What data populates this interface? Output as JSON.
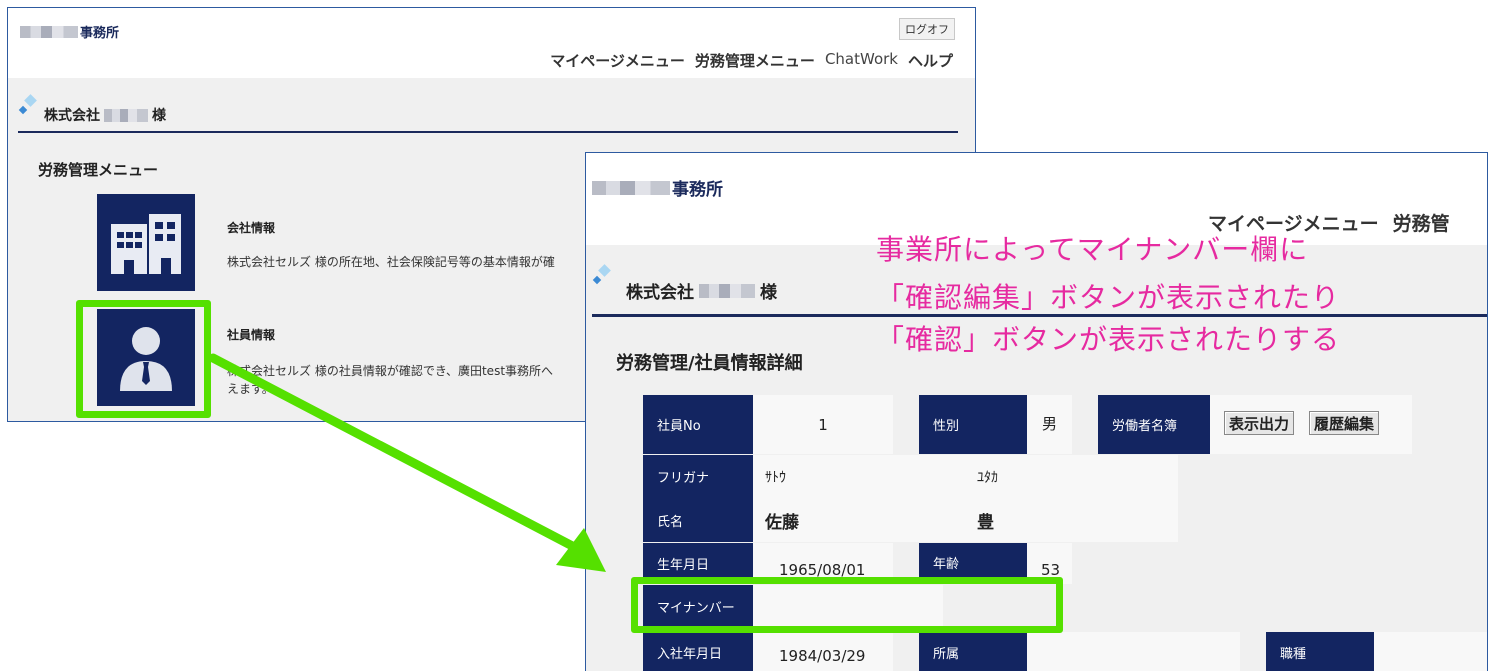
{
  "back_window": {
    "office_suffix": "事務所",
    "logoff_label": "ログオフ",
    "nav": [
      "マイページメニュー",
      "労務管理メニュー",
      "ChatWork",
      "ヘルプ"
    ],
    "company_prefix": "株式会社",
    "company_suffix": "様",
    "section_title": "労務管理メニュー",
    "cards": [
      {
        "title": "会社情報",
        "desc": "株式会社セルズ 様の所在地、社会保険記号等の基本情報が確",
        "icon": "building-icon"
      },
      {
        "title": "社員情報",
        "desc_line1": "株式会社セルズ 様の社員情報が確認でき、廣田test事務所へ",
        "desc_line2": "えます。",
        "icon": "person-icon"
      }
    ]
  },
  "front_window": {
    "office_suffix": "事務所",
    "nav": [
      "マイページメニュー",
      "労務管"
    ],
    "company_prefix": "株式会社",
    "company_suffix": "様",
    "section_title": "労務管理/社員情報詳細",
    "fields": {
      "employee_no_label": "社員No",
      "employee_no": "1",
      "gender_label": "性別",
      "gender": "男",
      "roster_label": "労働者名簿",
      "print_button": "表示出力",
      "history_button": "履歴編集",
      "furigana_label": "フリガナ",
      "furigana_last": "ｻﾄｳ",
      "furigana_first": "ﾕﾀｶ",
      "name_label": "氏名",
      "name_last": "佐藤",
      "name_first": "豊",
      "birthdate_label": "生年月日",
      "birthdate": "1965/08/01",
      "age_label": "年齢",
      "age": "53",
      "mynumber_label": "マイナンバー",
      "hire_date_label": "入社年月日",
      "hire_date": "1984/03/29",
      "department_label": "所属",
      "job_type_label": "職種"
    }
  },
  "annotation": {
    "lines": [
      "事業所によってマイナンバー欄に",
      "「確認編集」ボタンが表示されたり",
      "「確認」ボタンが表示されたりする"
    ],
    "color": "#e62aa0"
  },
  "highlight_color": "#55e000",
  "tile_color": "#132561"
}
